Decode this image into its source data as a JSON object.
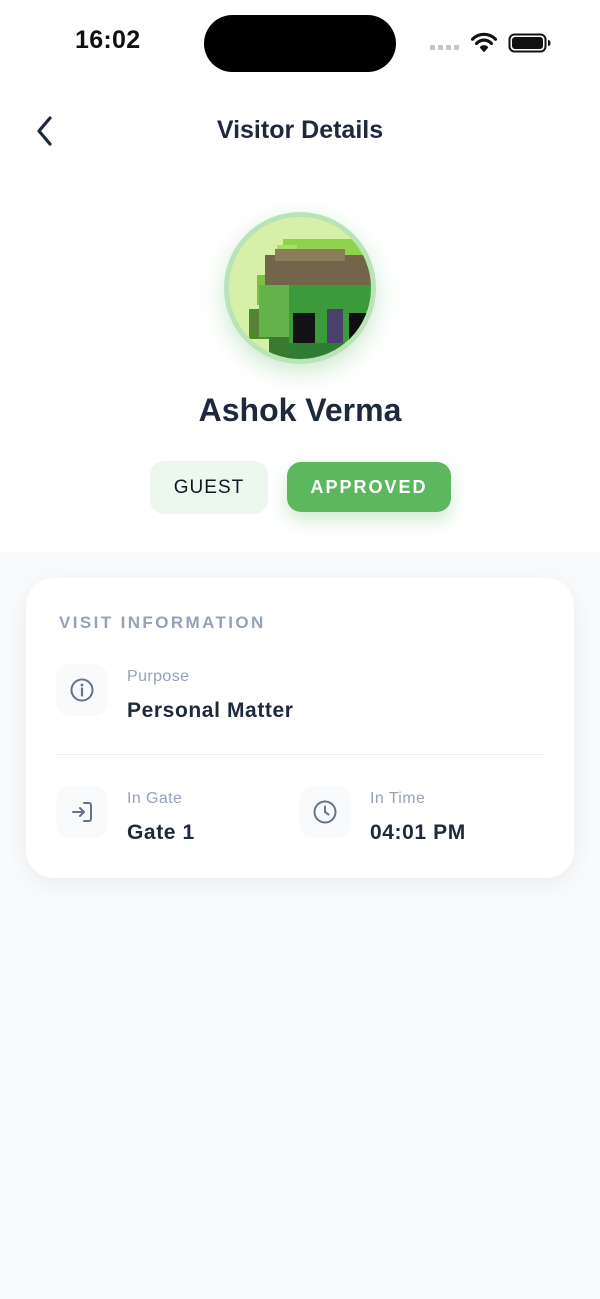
{
  "status_bar": {
    "time": "16:02"
  },
  "header": {
    "title": "Visitor Details"
  },
  "visitor": {
    "name": "Ashok Verma",
    "type_badge": "GUEST",
    "status_badge": "APPROVED"
  },
  "visit_info": {
    "section_title": "VISIT INFORMATION",
    "purpose": {
      "label": "Purpose",
      "value": "Personal Matter",
      "icon": "info-icon"
    },
    "in_gate": {
      "label": "In Gate",
      "value": "Gate 1",
      "icon": "login-icon"
    },
    "in_time": {
      "label": "In Time",
      "value": "04:01 PM",
      "icon": "clock-icon"
    }
  },
  "colors": {
    "accent_green": "#5cb85f",
    "guest_badge_bg": "#ecf7ee",
    "title_text": "#1e293b",
    "muted_text": "#94a3b8",
    "page_background": "#f8fafc"
  }
}
